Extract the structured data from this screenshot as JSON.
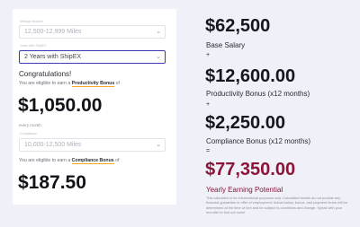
{
  "left": {
    "mileage_label": "Mileage Bracket",
    "mileage_value": "12,500-12,999 Miles",
    "years_label": "Years with ShipEX",
    "years_value": "2 Years with ShipEX",
    "congrats": "Congratulations!",
    "productivity_note_prefix": "You are eligible to earn a ",
    "productivity_note_strong": "Productivity Bonus",
    "productivity_note_suffix": " of",
    "productivity_amount": "$1,050.00",
    "productivity_period": "every month",
    "compliance_label": "Compliance",
    "compliance_value": "10,000-12,500 Miles",
    "compliance_note_prefix": "You are eligible to earn a ",
    "compliance_note_strong": "Compliance Bonus",
    "compliance_note_suffix": " of",
    "compliance_amount": "$187.50"
  },
  "right": {
    "base_amount": "$62,500",
    "base_label": "Base Salary",
    "plus1": "+",
    "productivity_amount": "$12,600.00",
    "productivity_label": "Productivity Bonus (x12 months)",
    "plus2": "+",
    "compliance_amount": "$2,250.00",
    "compliance_label": "Compliance Bonus (x12 months)",
    "equals": "=",
    "total_amount": "$77,350.00",
    "total_label": "Yearly Earning Potential",
    "disclaimer": "This calculator is for informational purposes only. Calculated results do not provide any financial guarantee or offer of employment. Actual salary, bonus, and payment terms will be determined at the time of hire and be subject to conditions and change. Speak with your recruiter to find out more!"
  },
  "colors": {
    "page_bg": "#eff0f8",
    "accent_underline": "#f5a623",
    "active_border": "#3b3bb8",
    "total_color": "#8b1538"
  }
}
